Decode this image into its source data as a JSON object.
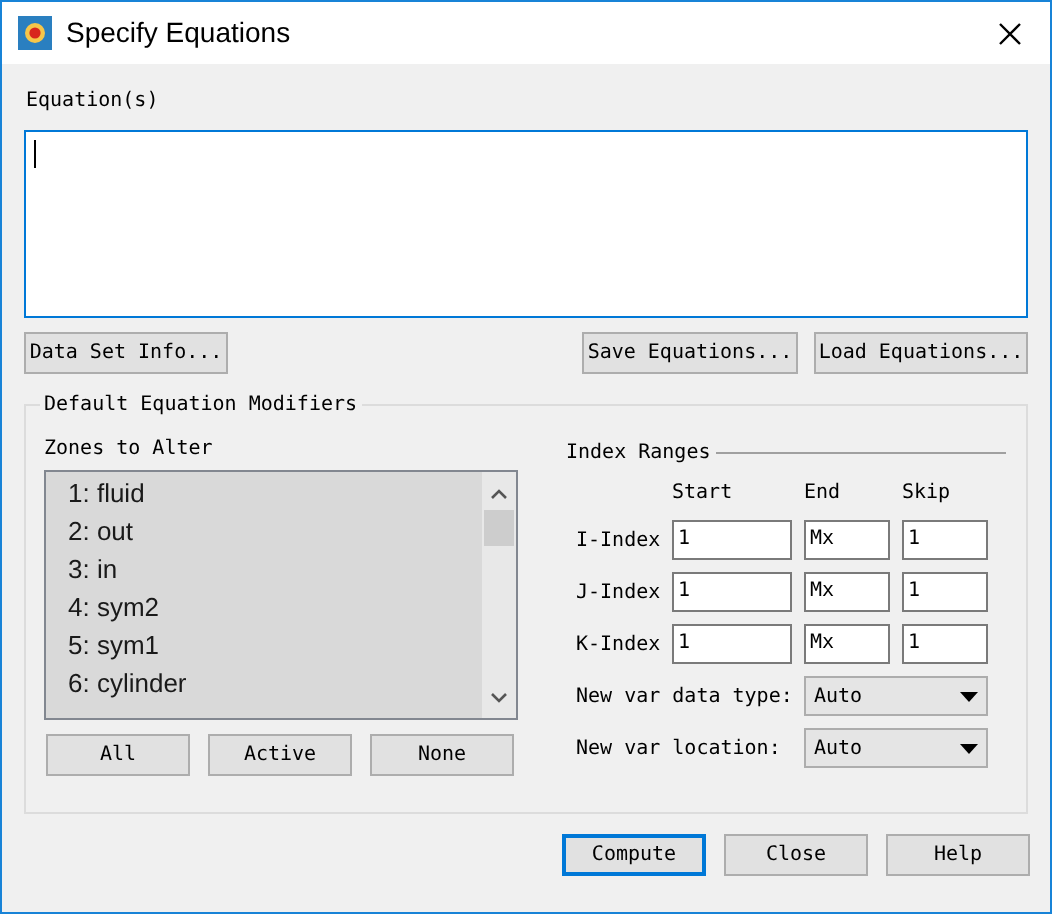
{
  "window": {
    "title": "Specify Equations"
  },
  "equations": {
    "label": "Equation(s)",
    "focused": true
  },
  "equation_buttons": [
    "Data Set Info...",
    "Save Equations...",
    "Load Equations..."
  ],
  "modifiers": {
    "title": "Default Equation Modifiers",
    "zones": {
      "label": "Zones to Alter",
      "items": [
        {
          "label": "1: fluid",
          "selected": true
        },
        {
          "label": "2: out",
          "selected": true
        },
        {
          "label": "3: in",
          "selected": true
        },
        {
          "label": "4: sym2",
          "selected": true
        },
        {
          "label": "5: sym1",
          "selected": true
        },
        {
          "label": "6: cylinder",
          "selected": true
        }
      ],
      "buttons": [
        "All",
        "Active",
        "None"
      ]
    },
    "index_ranges": {
      "title": "Index Ranges",
      "columns": [
        "Start",
        "End",
        "Skip"
      ],
      "rows": [
        {
          "label": "I-Index",
          "start": "1",
          "end": "Mx",
          "skip": "1"
        },
        {
          "label": "J-Index",
          "start": "1",
          "end": "Mx",
          "skip": "1"
        },
        {
          "label": "K-Index",
          "start": "1",
          "end": "Mx",
          "skip": "1"
        }
      ]
    },
    "options": [
      {
        "label": "New var data type:",
        "value": "Auto"
      },
      {
        "label": "New var location:",
        "value": "Auto"
      }
    ]
  },
  "buttons": [
    {
      "label": "Compute",
      "default": true
    },
    {
      "label": "Close",
      "default": false
    },
    {
      "label": "Help",
      "default": false
    }
  ]
}
